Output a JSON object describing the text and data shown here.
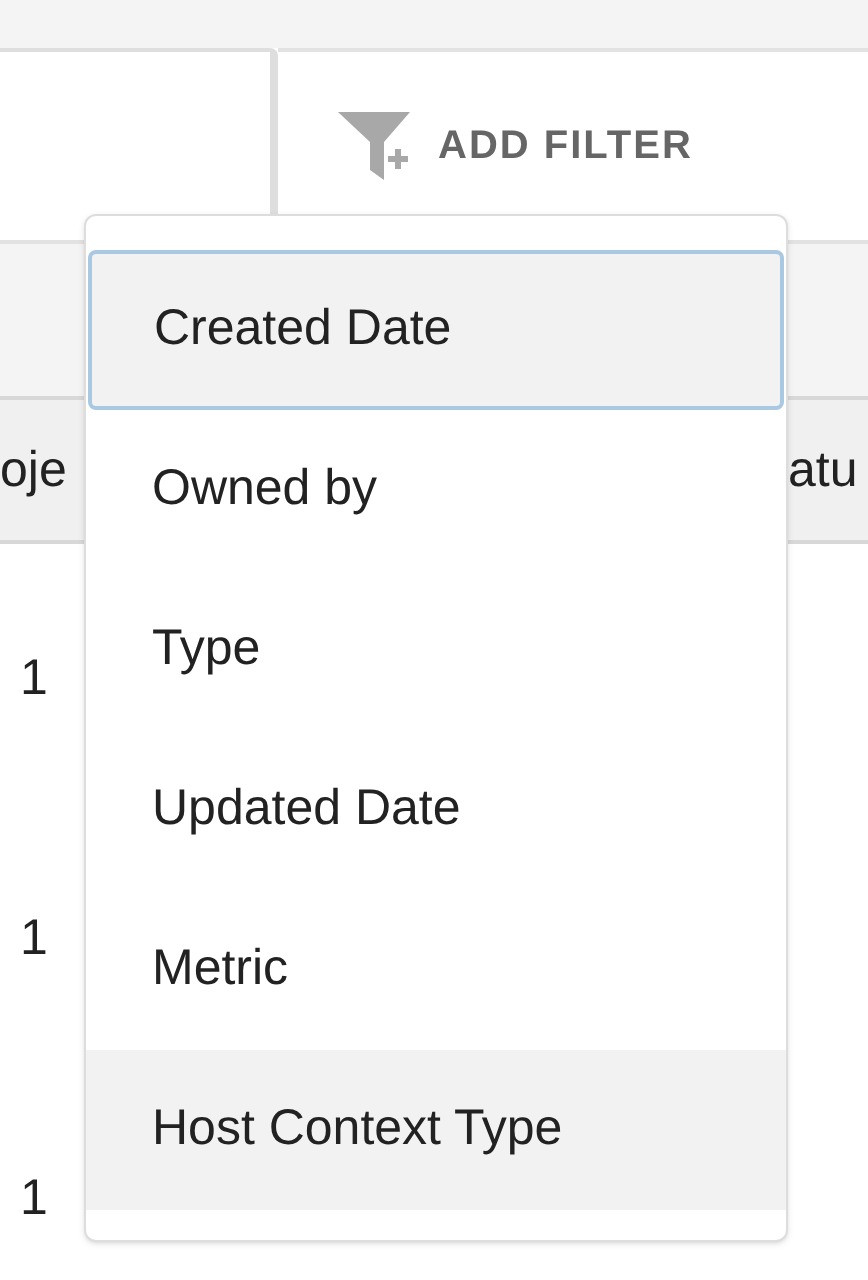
{
  "toolbar": {
    "add_filter_button": "ADD FILTER"
  },
  "table": {
    "columns": [
      "oje",
      "atu"
    ],
    "rows": [
      [
        "1"
      ],
      [
        "1"
      ],
      [
        "1"
      ]
    ]
  },
  "filter_menu": {
    "items": [
      {
        "label": "Created Date",
        "focused": true,
        "hovered": false
      },
      {
        "label": "Owned by",
        "focused": false,
        "hovered": false
      },
      {
        "label": "Type",
        "focused": false,
        "hovered": false
      },
      {
        "label": "Updated Date",
        "focused": false,
        "hovered": false
      },
      {
        "label": "Metric",
        "focused": false,
        "hovered": false
      },
      {
        "label": "Host Context Type",
        "focused": false,
        "hovered": true
      }
    ]
  }
}
